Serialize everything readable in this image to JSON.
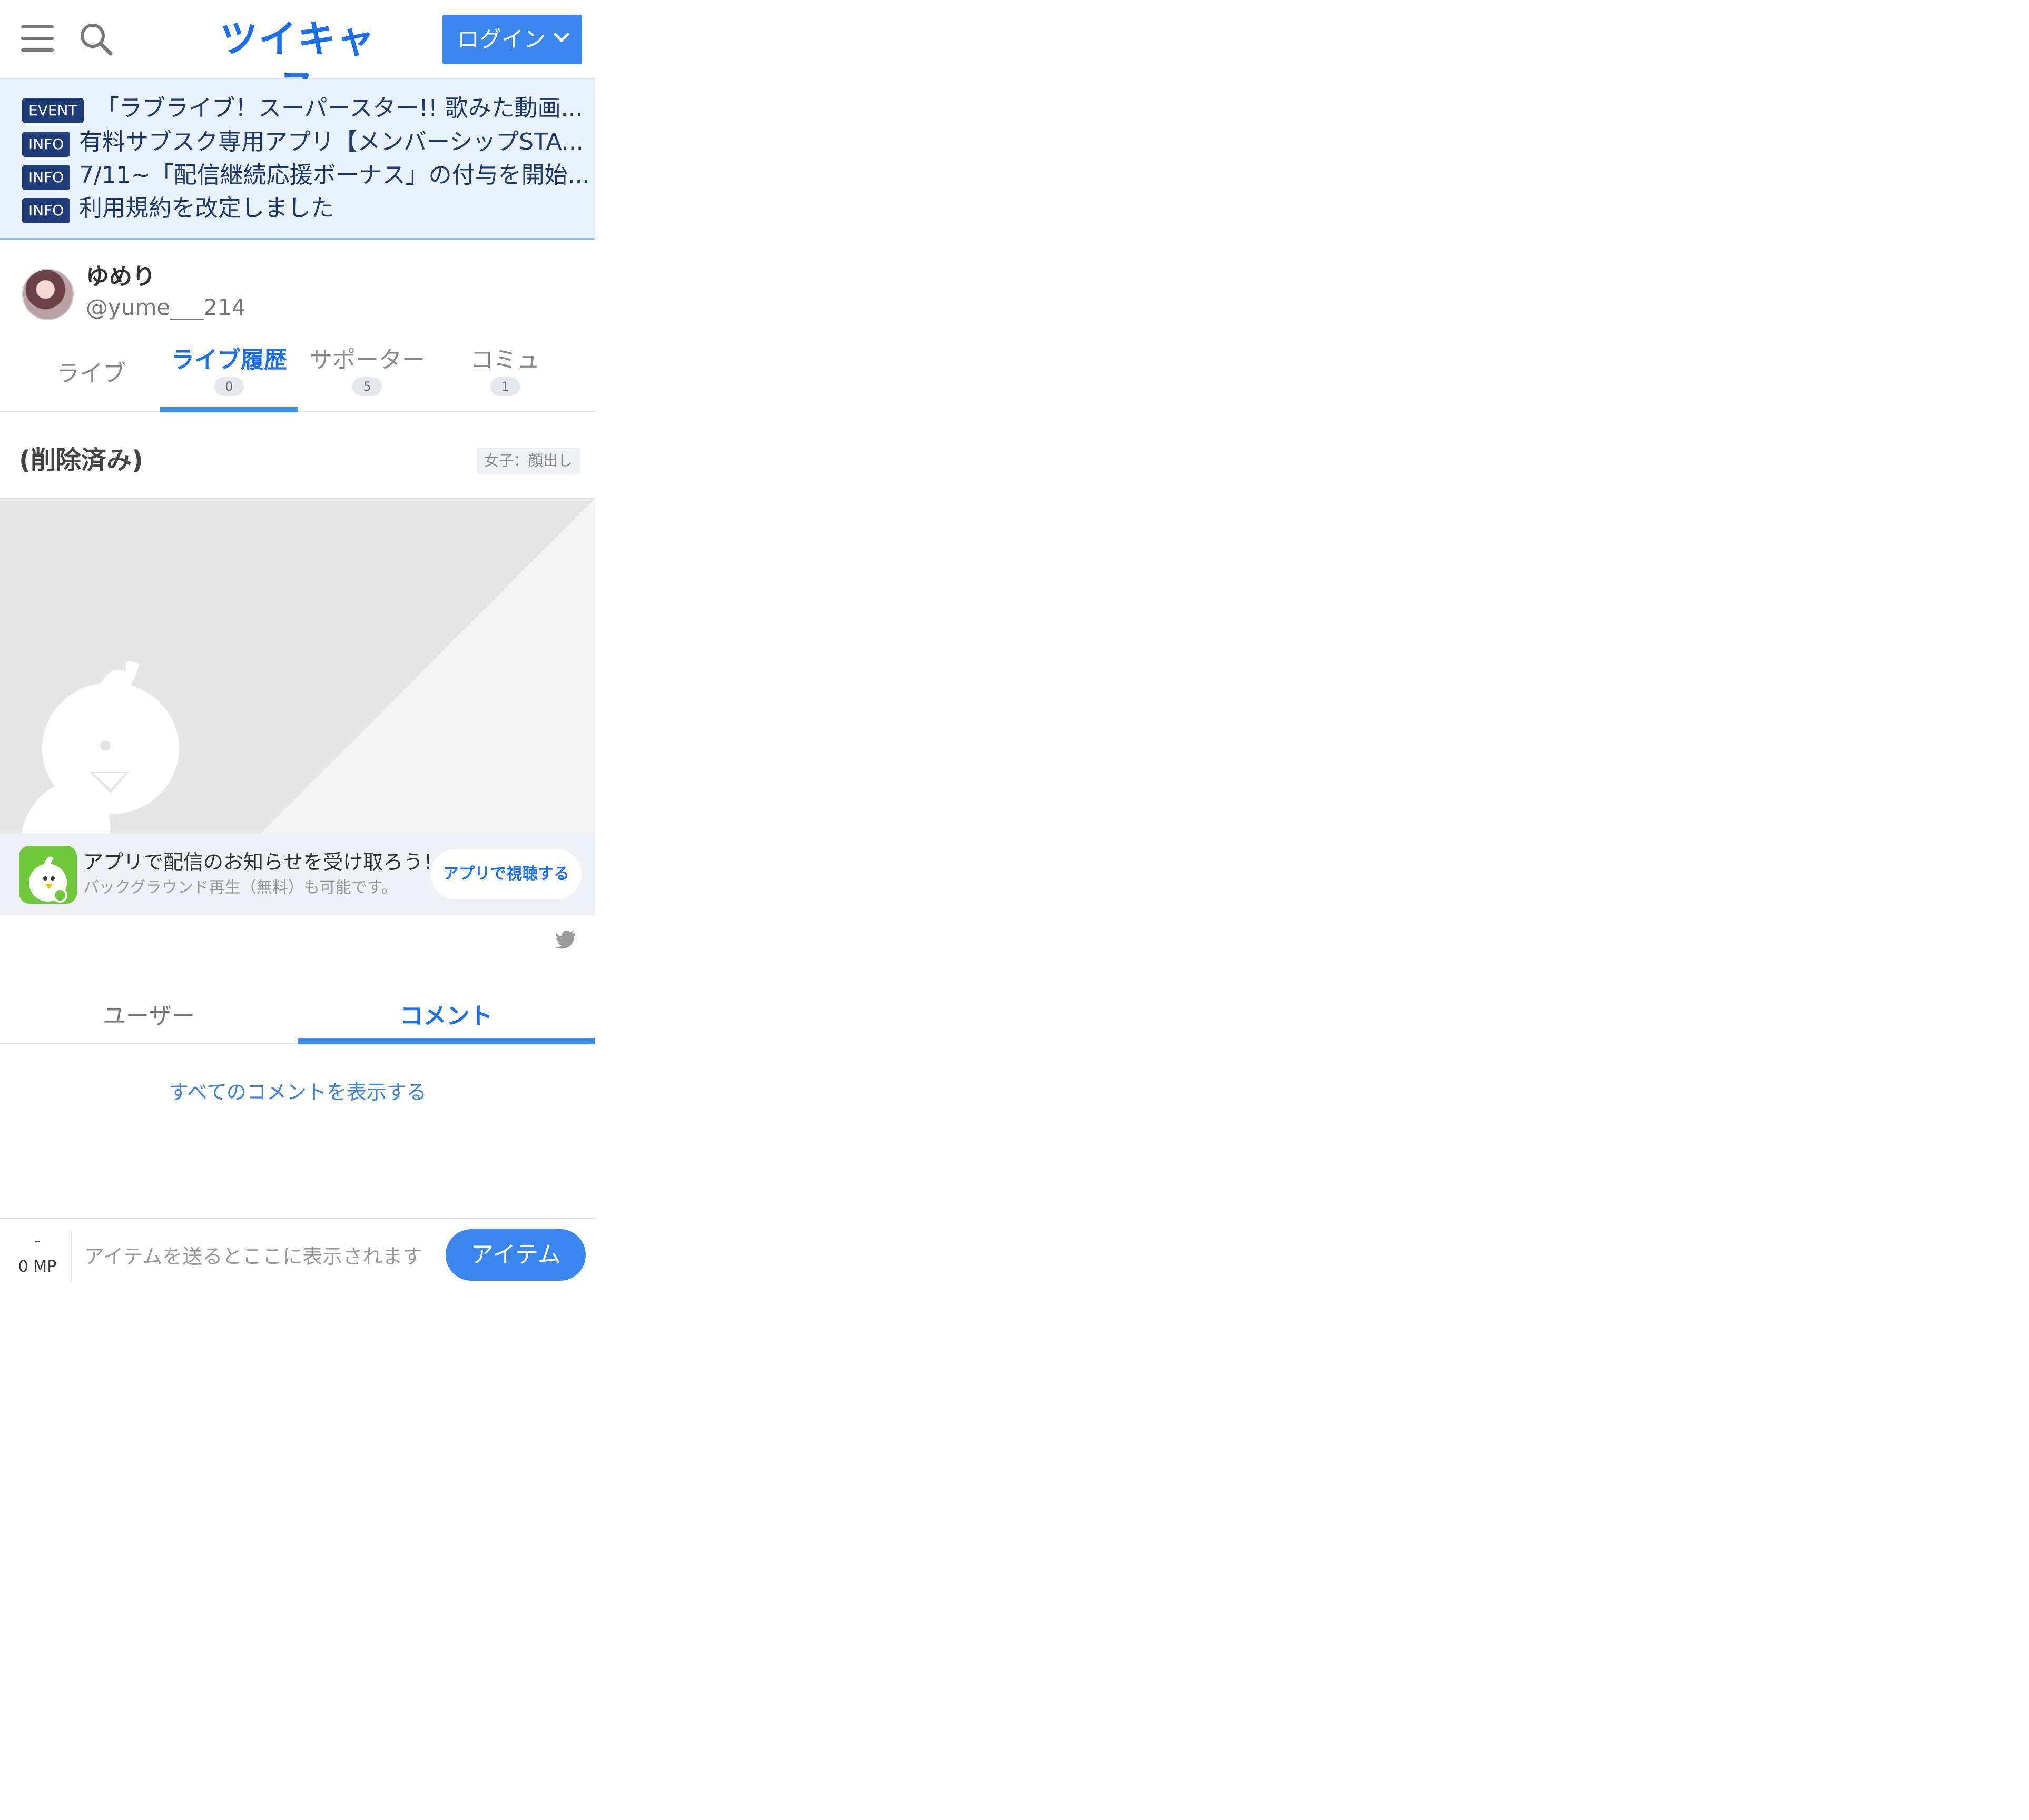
{
  "header": {
    "logo_text": "ツイキャス",
    "login_label": "ログイン",
    "menu_icon": "hamburger-menu-icon",
    "search_icon": "search-icon"
  },
  "news": [
    {
      "badge": "EVENT",
      "text": "「ラブライブ！スーパースター!! 歌みた動画..."
    },
    {
      "badge": "INFO",
      "text": "有料サブスク専用アプリ【メンバーシップSTA..."
    },
    {
      "badge": "INFO",
      "text": "7/11~「配信継続応援ボーナス」の付与を開始..."
    },
    {
      "badge": "INFO",
      "text": "利用規約を改定しました"
    }
  ],
  "profile": {
    "name": "ゆめり",
    "handle": "@yume___214"
  },
  "profile_tabs": [
    {
      "label": "ライブ"
    },
    {
      "label": "ライブ履歴",
      "count": "0",
      "active": true
    },
    {
      "label": "サポーター",
      "count": "5"
    },
    {
      "label": "コミュ",
      "count": "1"
    }
  ],
  "live": {
    "title": "(削除済み)",
    "tag": "女子：顔出し"
  },
  "app_banner": {
    "line1": "アプリで配信のお知らせを受け取ろう！",
    "line2": "バックグラウンド再生（無料）も可能です。",
    "button_label": "アプリで視聴する"
  },
  "comment_tabs": [
    {
      "label": "ユーザー"
    },
    {
      "label": "コメント",
      "active": true
    }
  ],
  "show_all_comments": "すべてのコメントを表示する",
  "bottom_bar": {
    "mp_dash": "-",
    "mp_value": "0 MP",
    "item_placeholder": "アイテムを送るとここに表示されます…",
    "item_button": "アイテム"
  },
  "colors": {
    "brand_blue": "#1c70f0",
    "button_blue": "#3a87f0",
    "news_background": "#e8f2fc",
    "badge_navy": "#1f3c78",
    "app_green": "#6fc93a"
  }
}
